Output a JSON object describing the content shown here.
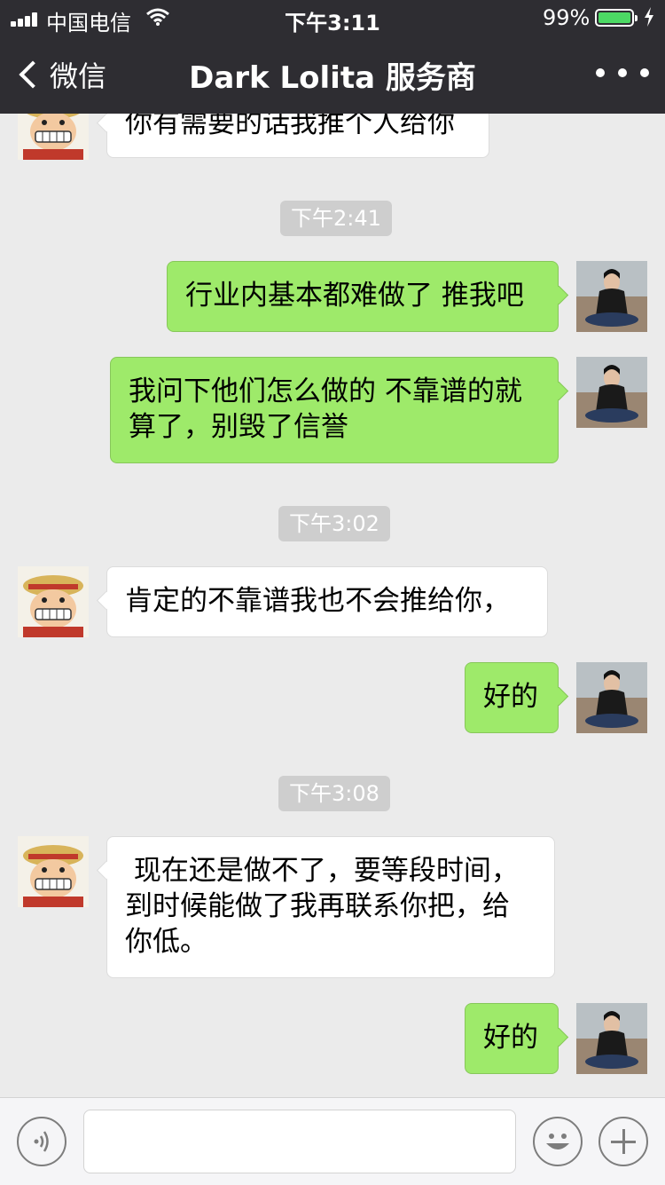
{
  "status_bar": {
    "carrier": "中国电信",
    "time": "下午3:11",
    "battery_percent": "99%",
    "signal_bars": 4,
    "battery_level": 0.99,
    "battery_color": "#4cd964"
  },
  "nav": {
    "back_label": "微信",
    "title": "Dark Lolita 服务商",
    "more_icon": "more-dots-icon"
  },
  "colors": {
    "nav_background": "#2e2d32",
    "chat_background": "#ebebeb",
    "outgoing_bubble": "#9eea6a",
    "incoming_bubble": "#ffffff",
    "timestamp_background": "#cecece"
  },
  "messages": [
    {
      "kind": "message",
      "side": "in",
      "text": "你有需要的话我推个人给你"
    },
    {
      "kind": "timestamp",
      "text": "下午2:41"
    },
    {
      "kind": "message",
      "side": "out",
      "text": "行业内基本都难做了 推我吧"
    },
    {
      "kind": "message",
      "side": "out",
      "text": "我问下他们怎么做的 不靠谱的就\n算了，别毁了信誉"
    },
    {
      "kind": "timestamp",
      "text": "下午3:02"
    },
    {
      "kind": "message",
      "side": "in",
      "text": "肯定的不靠谱我也不会推给你，"
    },
    {
      "kind": "message",
      "side": "out",
      "text": "好的"
    },
    {
      "kind": "timestamp",
      "text": "下午3:08"
    },
    {
      "kind": "message",
      "side": "in",
      "text": " 现在还是做不了，要等段时间，\n到时候能做了我再联系你把，给\n你低。"
    },
    {
      "kind": "message",
      "side": "out",
      "text": "好的"
    }
  ],
  "input_bar": {
    "voice_icon": "voice-icon",
    "text_value": "",
    "emoji_icon": "emoji-icon",
    "plus_icon": "plus-icon"
  }
}
